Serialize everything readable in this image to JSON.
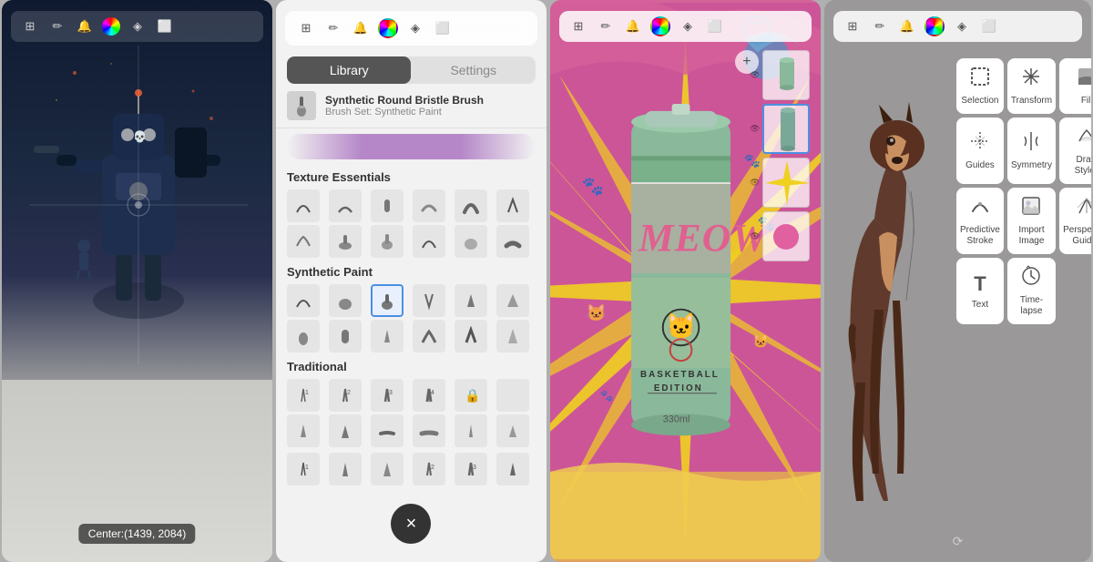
{
  "panels": {
    "panel1": {
      "toolbar": {
        "icons": [
          "grid-icon",
          "pen-icon",
          "brush-icon",
          "color-wheel-icon",
          "layers-icon",
          "canvas-icon"
        ]
      },
      "tools": {
        "icons": [
          "close-icon",
          "transform-icon",
          "selection-icon",
          "flip-icon",
          "color-pick-icon",
          "lock-icon",
          "menu-icon"
        ]
      },
      "status": {
        "text": "Center:(1439, 2084)"
      },
      "scene": "sci-fi painting with robot and figure in snow"
    },
    "panel2": {
      "tabs": [
        {
          "label": "Library",
          "active": true
        },
        {
          "label": "Settings",
          "active": false
        }
      ],
      "brush_info": {
        "name": "Synthetic Round Bristle Brush",
        "set": "Brush Set: Synthetic Paint"
      },
      "sections": [
        {
          "title": "Texture Essentials",
          "brushes": [
            "🖌️",
            "✏️",
            "🖊️",
            "📝",
            "🔲",
            "◾",
            "▪️",
            "⬛",
            "🌑",
            "▪️",
            "◼️",
            "⬛"
          ]
        },
        {
          "title": "Synthetic Paint",
          "brushes": [
            "🖌️",
            "✏️",
            "⬛",
            "◼️",
            "▲",
            "◾",
            "▪️",
            "◾",
            "◼️",
            "▪️",
            "▲",
            "◾",
            "⬛",
            "▪️",
            "◼️",
            "▪️",
            "▲",
            "◾"
          ],
          "selected_index": 2
        },
        {
          "title": "Traditional",
          "brushes": [
            "✏️",
            "📝",
            "✏️",
            "📝",
            "🔒",
            "",
            "▲",
            "▲",
            "➖",
            "➖",
            "✏️",
            "✒️",
            "✏️",
            "▲",
            "▲",
            "✏️",
            "✏️",
            "✏️"
          ]
        }
      ],
      "close_button": "×"
    },
    "panel3": {
      "toolbar": {
        "icons": [
          "grid-icon",
          "pen-icon",
          "brush-icon",
          "color-wheel-icon",
          "layers-icon",
          "canvas-icon"
        ]
      },
      "add_layer_button": "+",
      "layers": [
        {
          "selected": false,
          "visible": true
        },
        {
          "selected": false,
          "visible": true
        },
        {
          "selected": true,
          "visible": true
        },
        {
          "selected": false,
          "visible": true
        },
        {
          "selected": false,
          "visible": true
        }
      ],
      "scene": "MEOW basketball edition energy drink can illustration"
    },
    "panel4": {
      "toolbar": {
        "icons": [
          "grid-icon",
          "pen-icon",
          "brush-icon",
          "color-wheel-icon",
          "layers-icon",
          "canvas-icon"
        ]
      },
      "tools": [
        {
          "icon": "⊞",
          "label": "Selection"
        },
        {
          "icon": "⤢",
          "label": "Transform"
        },
        {
          "icon": "⬜",
          "label": "Fill"
        },
        {
          "icon": "✏️",
          "label": "Guides"
        },
        {
          "icon": "⟺",
          "label": "Symmetry"
        },
        {
          "icon": "🖊️",
          "label": "Draw Styles"
        },
        {
          "icon": "〰️",
          "label": "Predictive Stroke"
        },
        {
          "icon": "🖼️",
          "label": "Import Image"
        },
        {
          "icon": "⊞",
          "label": "Perspective Guides"
        },
        {
          "icon": "T",
          "label": "Text"
        },
        {
          "icon": "⏱️",
          "label": "Time-lapse"
        }
      ],
      "scene": "dog portrait drawing with tools panel"
    }
  }
}
